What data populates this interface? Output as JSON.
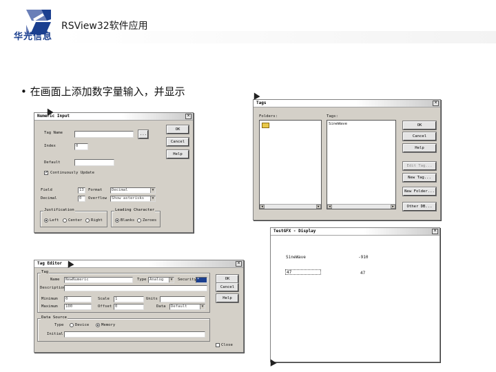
{
  "slide": {
    "logo_text": "华光信息",
    "title": "RSView32软件应用",
    "bullet": "• 在画面上添加数字量输入，并显示"
  },
  "numeric_input": {
    "title": "Numeric Input",
    "tag_name_label": "Tag Name",
    "browse": "...",
    "index_label": "Index",
    "index_value": "0",
    "default_label": "Default",
    "continuous_label": "Continuously Update",
    "field_label": "Field",
    "field_value": "13",
    "decimal_label": "Decimal",
    "decimal_value": "0",
    "format_label": "Format",
    "format_value": "Decimal",
    "overflow_label": "Overflow",
    "overflow_value": "Show asterisks",
    "justification_title": "Justification",
    "just_left": "Left",
    "just_center": "Center",
    "just_right": "Right",
    "leading_title": "Leading Character",
    "lead_blanks": "Blanks",
    "lead_zeroes": "Zeroes",
    "ok": "OK",
    "cancel": "Cancel",
    "help": "Help"
  },
  "tags": {
    "title": "Tags",
    "folders_label": "Folders:",
    "tags_label": "Tags:",
    "tag_item": "SineWave",
    "ok": "OK",
    "cancel": "Cancel",
    "help": "Help",
    "edit_tag": "Edit Tag...",
    "new_tag": "New Tag...",
    "new_folder": "New Folder...",
    "other_db": "Other DB..."
  },
  "tag_editor": {
    "title": "Tag Editor",
    "tag_group": "Tag",
    "name_label": "Name",
    "name_value": "NewNumeric",
    "type_label": "Type",
    "type_value": "Analog",
    "security_label": "Security",
    "security_value": "*",
    "description_label": "Description",
    "minimum_label": "Minimum",
    "minimum_value": "0",
    "maximum_label": "Maximum",
    "maximum_value": "100",
    "scale_label": "Scale",
    "scale_value": "1",
    "offset_label": "Offset",
    "offset_value": "0",
    "units_label": "Units",
    "data_label": "Data",
    "data_value": "Default",
    "data_source_title": "Data Source",
    "ds_type_label": "Type",
    "ds_device": "Device",
    "ds_memory": "Memory",
    "initial_label": "Initial",
    "ok": "OK",
    "cancel": "Cancel",
    "help": "Help",
    "close_label": "Close"
  },
  "display": {
    "title": "TestGFX - Display",
    "tag_label": "SineWave",
    "tag_value": "-910",
    "input_value": "47",
    "right_value": "47"
  }
}
